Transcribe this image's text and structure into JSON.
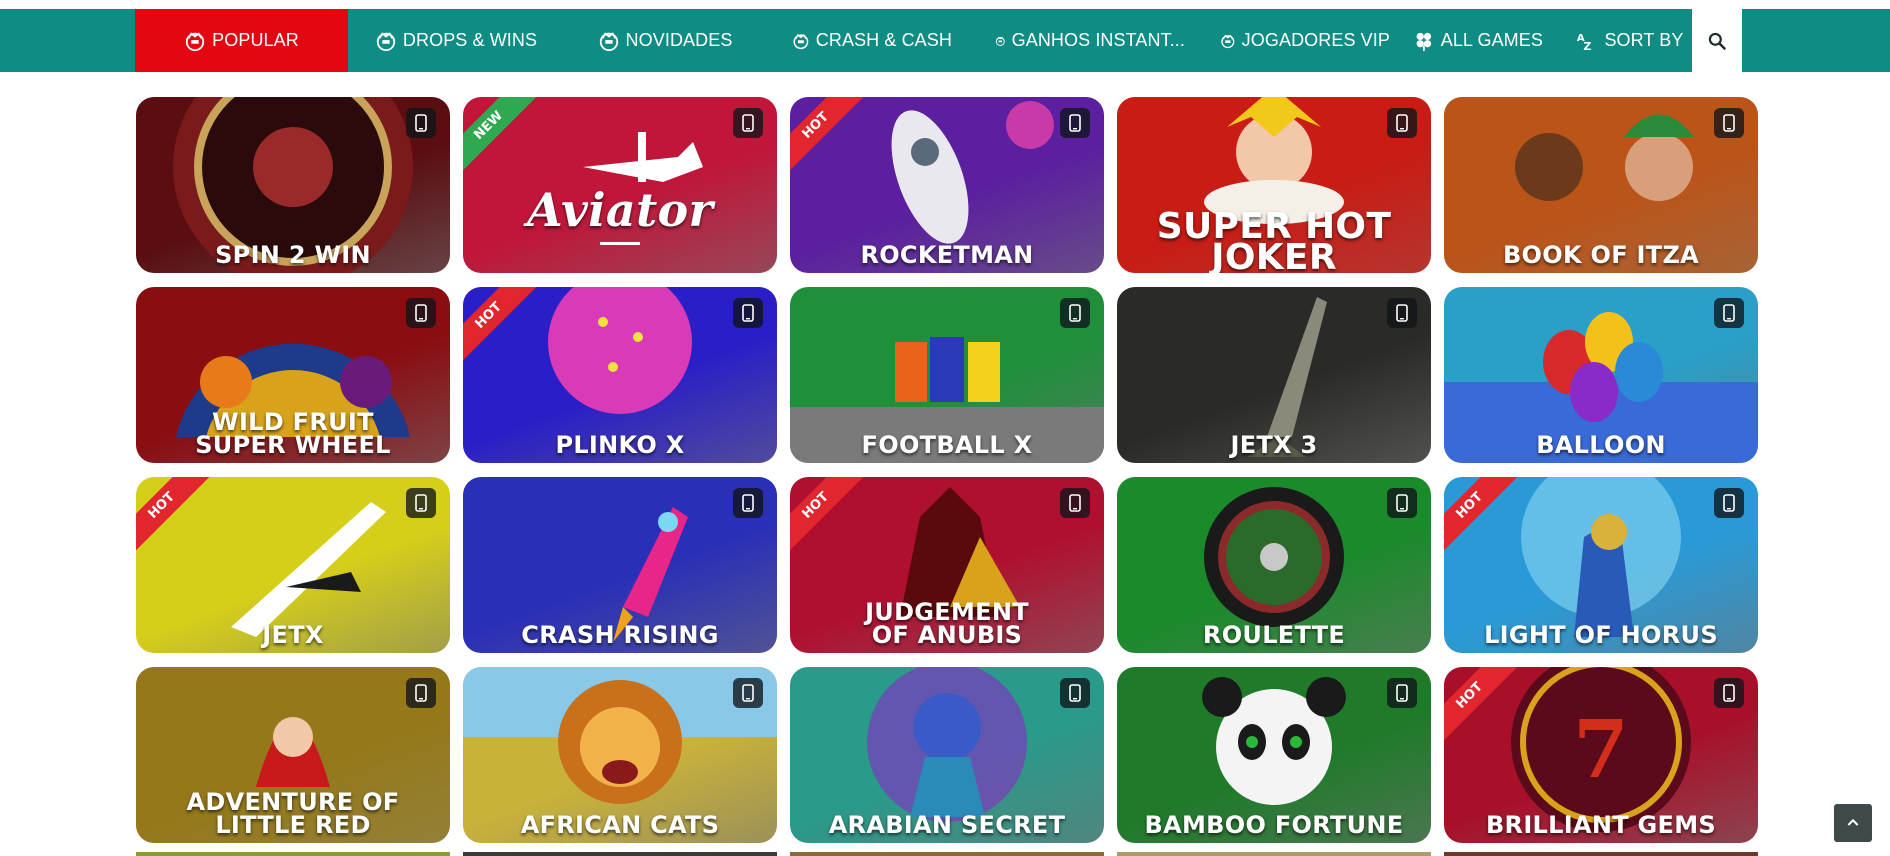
{
  "nav": {
    "items": [
      {
        "label": "POPULAR",
        "icon": "casino-chip-icon",
        "active": true
      },
      {
        "label": "DROPS & WINS",
        "icon": "casino-chip-icon",
        "active": false
      },
      {
        "label": "NOVIDADES",
        "icon": "casino-chip-icon",
        "active": false
      },
      {
        "label": "CRASH & CASH",
        "icon": "casino-chip-icon",
        "active": false
      },
      {
        "label": "GANHOS INSTANT...",
        "icon": "casino-chip-icon",
        "active": false
      },
      {
        "label": "JOGADORES VIP",
        "icon": "casino-chip-icon",
        "active": false
      },
      {
        "label": "ALL GAMES",
        "icon": "clover-icon",
        "active": false
      },
      {
        "label": "SORT BY",
        "icon": "sort-az-icon",
        "active": false
      }
    ],
    "search_icon": "search-icon",
    "colors": {
      "bar": "#0f8c84",
      "active": "#e30613"
    }
  },
  "games": [
    {
      "title": "SPIN 2 WIN",
      "badge": "",
      "bg": "#5a0e12"
    },
    {
      "title": "Aviator",
      "badge": "NEW",
      "bg": "#c0163a"
    },
    {
      "title": "ROCKETMAN",
      "badge": "HOT",
      "bg": "#5b1fa0"
    },
    {
      "title": "SUPER HOT\nJOKER",
      "badge": "",
      "bg": "#b8120f"
    },
    {
      "title": "BOOK OF ITZA",
      "badge": "",
      "bg": "#b3411a"
    },
    {
      "title": "WILD FRUIT\nSUPER WHEEL",
      "badge": "",
      "bg": "#8a0d12"
    },
    {
      "title": "PLINKO X",
      "badge": "HOT",
      "bg": "#2a1fc7"
    },
    {
      "title": "FOOTBALL X",
      "badge": "",
      "bg": "#1f8f3c"
    },
    {
      "title": "JETX 3",
      "badge": "",
      "bg": "#2a2a26"
    },
    {
      "title": "BALLOON",
      "badge": "",
      "bg": "#2a9fc7"
    },
    {
      "title": "JETX",
      "badge": "HOT",
      "bg": "#d6cf1a"
    },
    {
      "title": "CRASH RISING",
      "badge": "",
      "bg": "#2a2fb8"
    },
    {
      "title": "JUDGEMENT\nOF ANUBIS",
      "badge": "HOT",
      "bg": "#b01030"
    },
    {
      "title": "ROULETTE",
      "badge": "",
      "bg": "#1a8a2a"
    },
    {
      "title": "LIGHT OF HORUS",
      "badge": "HOT",
      "bg": "#2a9ad6"
    },
    {
      "title": "ADVENTURE OF\nLITTLE RED",
      "badge": "",
      "bg": "#7a5a1a"
    },
    {
      "title": "AFRICAN CATS",
      "badge": "",
      "bg": "#c9b23a"
    },
    {
      "title": "ARABIAN SECRET",
      "badge": "",
      "bg": "#2a9a8a"
    },
    {
      "title": "BAMBOO FORTUNE",
      "badge": "",
      "bg": "#1f7a2a"
    },
    {
      "title": "BRILLIANT GEMS",
      "badge": "HOT",
      "bg": "#a8102a"
    }
  ],
  "tile_icon": "mobile-phone-icon",
  "scroll_top_icon": "chevron-up-icon"
}
